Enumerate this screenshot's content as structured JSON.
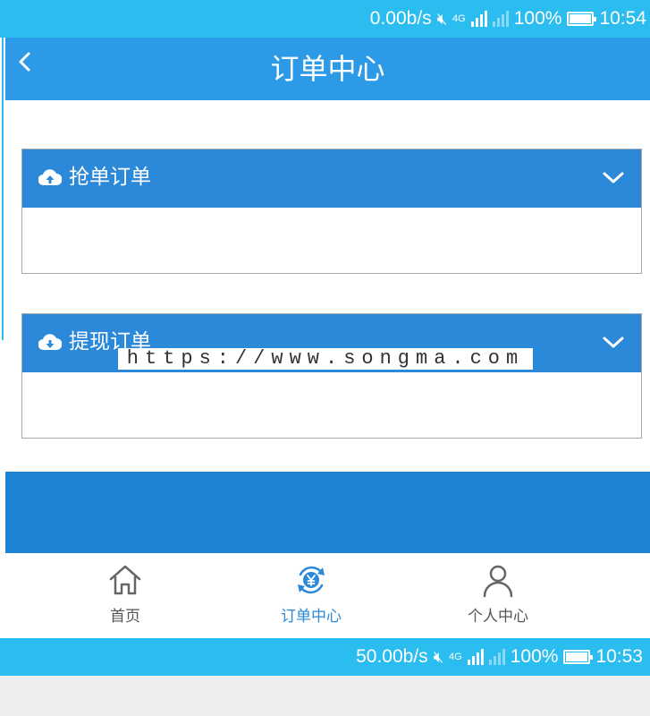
{
  "status_top": {
    "speed": "0.00b/s",
    "network": "4G",
    "battery": "100%",
    "time": "10:54"
  },
  "header": {
    "back_icon": "chevron-left-icon",
    "title": "订单中心"
  },
  "panels": [
    {
      "icon": "cloud-upload-icon",
      "title": "抢单订单",
      "expand_icon": "chevron-down-icon"
    },
    {
      "icon": "cloud-download-icon",
      "title": "提现订单",
      "expand_icon": "chevron-down-icon"
    }
  ],
  "watermark": "https://www.songma.com",
  "tabs": [
    {
      "icon": "home-icon",
      "label": "首页",
      "active": false
    },
    {
      "icon": "yuan-exchange-icon",
      "label": "订单中心",
      "active": true
    },
    {
      "icon": "user-icon",
      "label": "个人中心",
      "active": false
    }
  ],
  "status_bottom": {
    "speed": "50.00b/s",
    "network": "4G",
    "battery": "100%",
    "time": "10:53"
  },
  "colors": {
    "statusbar": "#2bbcf0",
    "header": "#2c9ae6",
    "panel_head": "#2c88d8",
    "block": "#1e83d3",
    "active_tab": "#2c88d8"
  }
}
